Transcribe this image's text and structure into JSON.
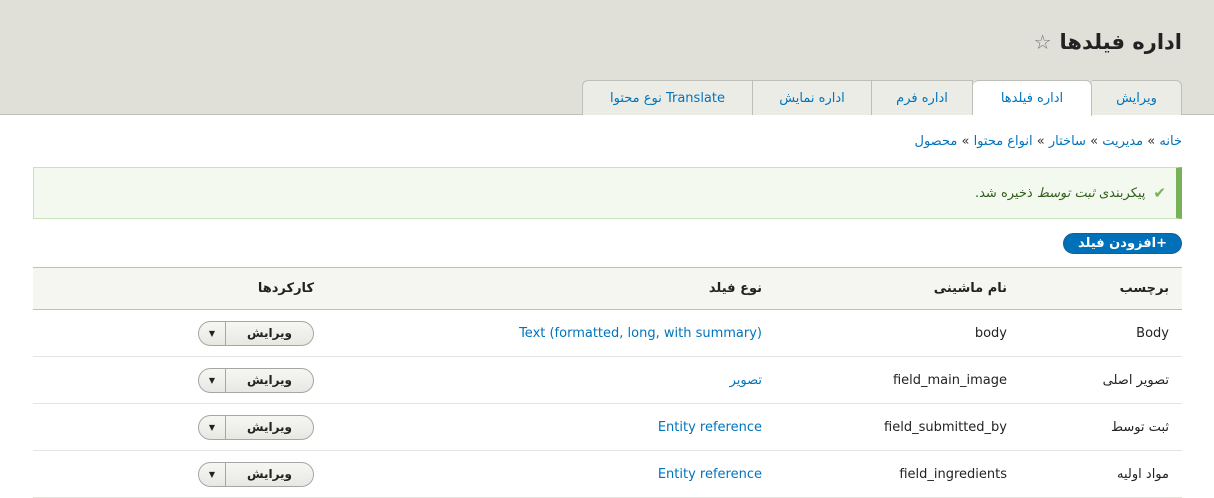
{
  "page": {
    "title": "اداره فیلدها",
    "star_icon": "star-icon"
  },
  "tabs": [
    {
      "label": "ویرایش"
    },
    {
      "label": "اداره فیلدها"
    },
    {
      "label": "اداره فرم"
    },
    {
      "label": "اداره نمایش"
    },
    {
      "label": "Translate نوع محتوا"
    }
  ],
  "breadcrumb": [
    {
      "label": "خانه"
    },
    {
      "label": "مدیریت"
    },
    {
      "label": "ساختار"
    },
    {
      "label": "انواع محتوا"
    },
    {
      "label": "محصول"
    }
  ],
  "breadcrumb_sep": "»",
  "message": {
    "before": "پیکربندی ",
    "em": "ثبت توسط",
    "after": " ذخیره شد."
  },
  "add_button": "+افزودن فیلد",
  "table": {
    "headers": [
      "برچسب",
      "نام ماشینی",
      "نوع فیلد",
      "کارکردها"
    ],
    "rows": [
      {
        "label": "Body",
        "machine": "body",
        "type": "Text (formatted, long, with summary)",
        "op": "ویرایش"
      },
      {
        "label": "تصویر اصلی",
        "machine": "field_main_image",
        "type": "تصویر",
        "op": "ویرایش"
      },
      {
        "label": "ثبت توسط",
        "machine": "field_submitted_by",
        "type": "Entity reference",
        "op": "ویرایش"
      },
      {
        "label": "مواد اولیه",
        "machine": "field_ingredients",
        "type": "Entity reference",
        "op": "ویرایش"
      }
    ]
  }
}
